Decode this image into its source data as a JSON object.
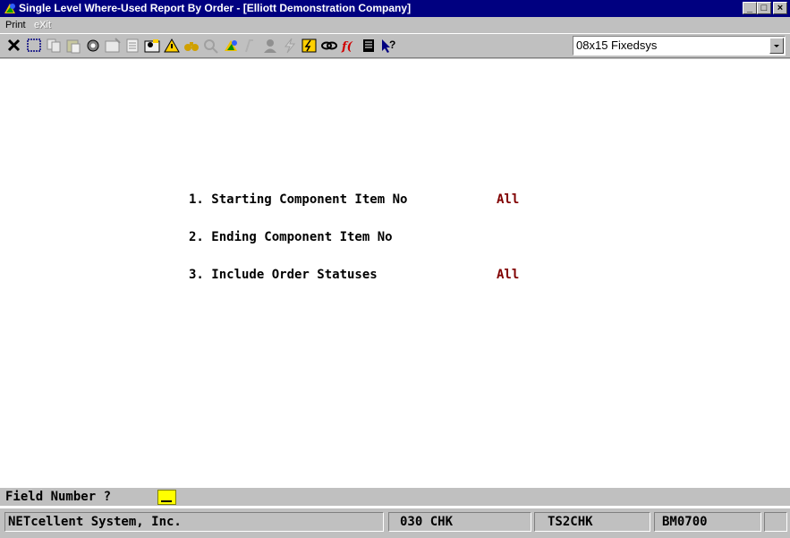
{
  "window": {
    "title": "Single Level Where-Used Report By Order - [Elliott Demonstration Company]",
    "minimize_glyph": "_",
    "maximize_glyph": "□",
    "close_glyph": "×"
  },
  "menu": {
    "print": "Print",
    "exit": "eXit"
  },
  "toolbar": {
    "icons": [
      "delete-x-icon",
      "select-box-icon",
      "copy-icon",
      "paste-icon",
      "settings-gear-icon",
      "properties-icon",
      "notepad-icon",
      "user-card-icon",
      "warning-icon",
      "binoculars-icon",
      "search-magnifier-icon",
      "macro-icon",
      "script-icon",
      "user-icon",
      "lightning-icon",
      "batch-icon",
      "link-icon",
      "function-icon",
      "calculator-icon",
      "help-arrow-icon"
    ],
    "font_select": "08x15 Fixedsys"
  },
  "form": {
    "fields": [
      {
        "label": "1. Starting Component Item No",
        "value": "All"
      },
      {
        "label": "2. Ending Component Item No",
        "value": ""
      },
      {
        "label": "3. Include Order Statuses",
        "value": "All"
      }
    ]
  },
  "prompt": {
    "text": "Field Number ?"
  },
  "status": {
    "company": "NETcellent System, Inc.",
    "segment1": "030 CHK",
    "segment2": "TS2CHK",
    "segment3": "BM0700"
  },
  "colors": {
    "title_bar": "#000080",
    "field_value": "#800000",
    "input_highlight": "#ffff00"
  }
}
